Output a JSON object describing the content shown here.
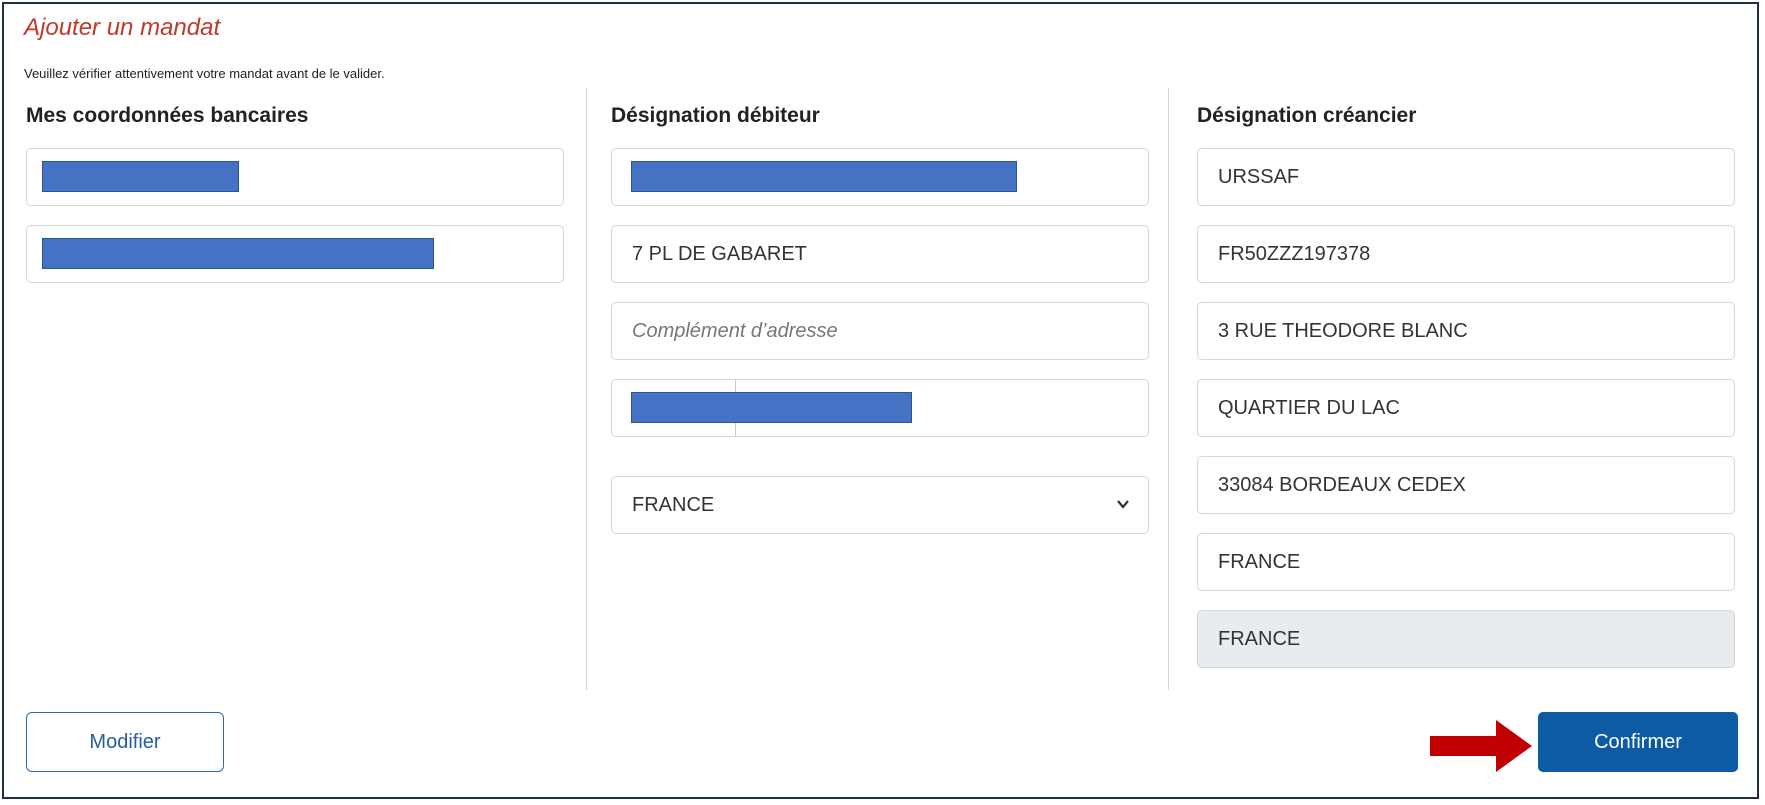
{
  "header": {
    "title": "Ajouter un mandat",
    "instruction": "Veuillez vérifier attentivement votre mandat avant de le valider."
  },
  "bank": {
    "heading": "Mes coordonnées bancaires"
  },
  "debtor": {
    "heading": "Désignation débiteur",
    "address_line": "7   PL DE GABARET",
    "address_complement_placeholder": "Complément d’adresse",
    "country_selected": "FRANCE"
  },
  "creditor": {
    "heading": "Désignation créancier",
    "name": "URSSAF",
    "identifier": "FR50ZZZ197378",
    "street": "3 RUE THEODORE BLANC",
    "district": "QUARTIER DU LAC",
    "postal_city": "33084 BORDEAUX CEDEX",
    "country": "FRANCE",
    "country_disabled": "FRANCE"
  },
  "actions": {
    "modify_label": "Modifier",
    "confirm_label": "Confirmer"
  },
  "colors": {
    "title": "#c0392b",
    "primary_button": "#0d5aa5",
    "redaction": "#4472c4",
    "arrow": "#c00000"
  },
  "icons": {
    "select_caret": "chevron-down-icon",
    "annotation": "arrow-right-icon"
  }
}
